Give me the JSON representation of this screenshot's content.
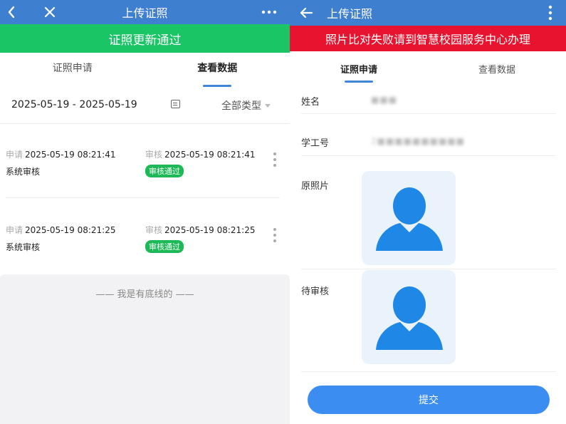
{
  "left": {
    "title": "上传证照",
    "banner": "证照更新通过",
    "tabs": [
      "证照申请",
      "查看数据"
    ],
    "date_range": "2025-05-19 - 2025-05-19",
    "type_filter": "全部类型",
    "records": [
      {
        "apply_label": "申请",
        "apply_time": "2025-05-19 08:21:41",
        "review_label": "审核",
        "review_time": "2025-05-19 08:21:41",
        "reviewer": "系统审核",
        "status": "审核通过"
      },
      {
        "apply_label": "申请",
        "apply_time": "2025-05-19 08:21:25",
        "review_label": "审核",
        "review_time": "2025-05-19 08:21:25",
        "reviewer": "系统审核",
        "status": "审核通过"
      }
    ],
    "footer": "—— 我是有底线的 ——"
  },
  "right": {
    "title": "上传证照",
    "banner": "照片比对失败请到智慧校园服务中心办理",
    "tabs": [
      "证照申请",
      "查看数据"
    ],
    "fields": {
      "name_label": "姓名",
      "name_value": "■■■",
      "id_label": "学工号",
      "id_value": "2■■■■■■■■■■",
      "orig_photo_label": "原照片",
      "pending_label": "待审核"
    },
    "submit": "提交"
  },
  "colors": {
    "header": "#3f7fd0",
    "success": "#1ac565",
    "error": "#e8142f",
    "accent": "#3b8df2",
    "avatar": "#1f87e5"
  }
}
